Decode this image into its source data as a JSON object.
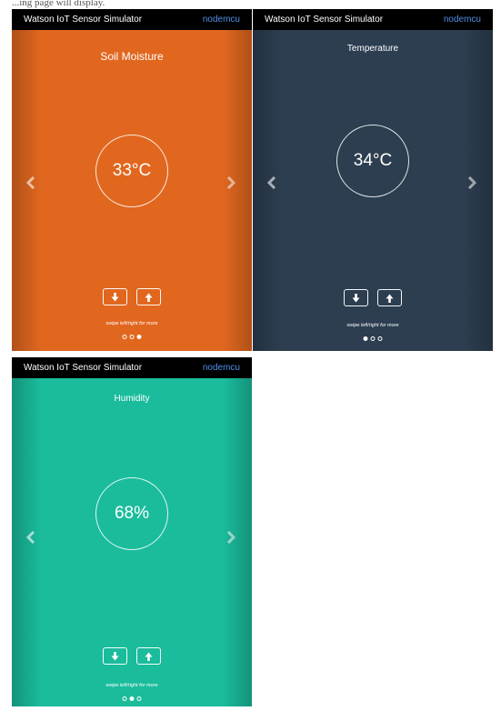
{
  "caption": "...ing page will display.",
  "colors": {
    "topbar": "#000000",
    "device_link": "#4f8fe8",
    "soil": "#e1671f",
    "temperature": "#2c3e50",
    "humidity": "#1abc9c"
  },
  "panels": [
    {
      "app_title": "Watson IoT Sensor Simulator",
      "device": "nodemcu",
      "sensor_title": "Soil Moisture",
      "value": "33°C",
      "down_icon": "arrow-down-icon",
      "up_icon": "arrow-up-icon",
      "swipe_hint": "swipe left/right for more",
      "active_dot": 3
    },
    {
      "app_title": "Watson IoT Sensor Simulator",
      "device": "nodemcu",
      "sensor_title": "Temperature",
      "value": "34°C",
      "down_icon": "arrow-down-icon",
      "up_icon": "arrow-up-icon",
      "swipe_hint": "swipe left/right for more",
      "active_dot": 1
    },
    {
      "app_title": "Watson IoT Sensor Simulator",
      "device": "nodemcu",
      "sensor_title": "Humidity",
      "value": "68%",
      "down_icon": "arrow-down-icon",
      "up_icon": "arrow-up-icon",
      "swipe_hint": "swipe left/right for more",
      "active_dot": 2
    }
  ]
}
